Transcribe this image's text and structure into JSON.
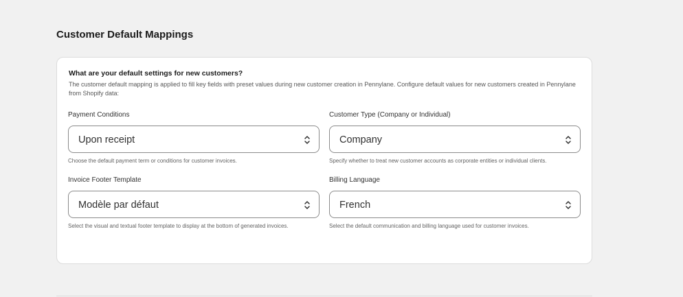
{
  "section": {
    "title": "Customer Default Mappings"
  },
  "card": {
    "heading": "What are your default settings for new customers?",
    "description": "The customer default mapping is applied to fill key fields with preset values during new customer creation in Pennylane. Configure default values for new customers created in Pennylane from Shopify data:"
  },
  "fields": {
    "payment_conditions": {
      "label": "Payment Conditions",
      "value": "Upon receipt",
      "help": "Choose the default payment term or conditions for customer invoices."
    },
    "customer_type": {
      "label": "Customer Type (Company or Individual)",
      "value": "Company",
      "help": "Specify whether to treat new customer accounts as corporate entities or individual clients."
    },
    "invoice_footer_template": {
      "label": "Invoice Footer Template",
      "value": "Modèle par défaut",
      "help": "Select the visual and textual footer template to display at the bottom of generated invoices."
    },
    "billing_language": {
      "label": "Billing Language",
      "value": "French",
      "help": "Select the default communication and billing language used for customer invoices."
    }
  },
  "icons": {
    "select_arrows": "select-chevron-up-down-icon"
  }
}
